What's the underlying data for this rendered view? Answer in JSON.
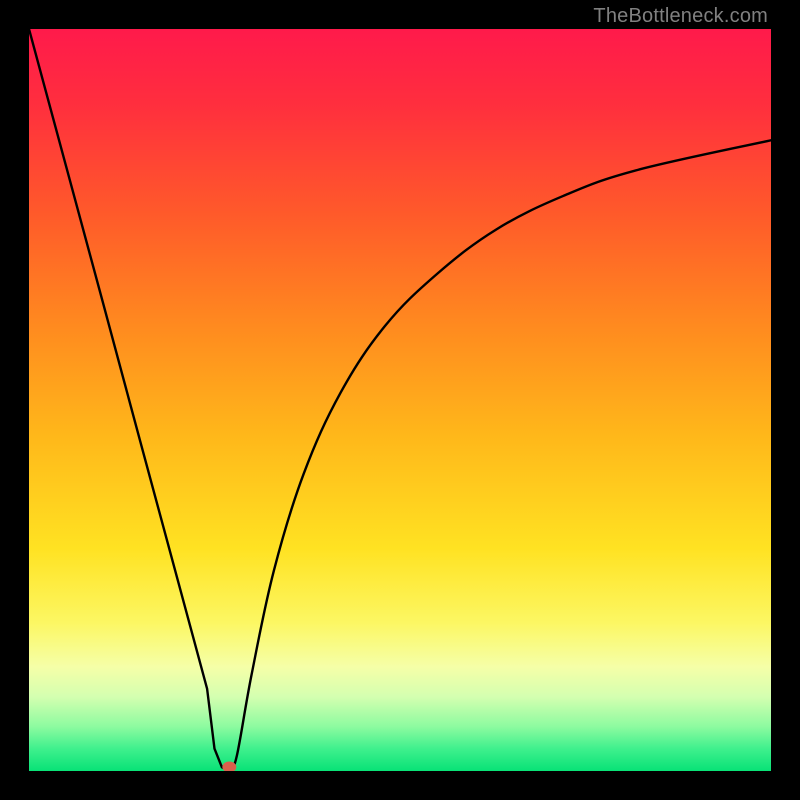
{
  "attribution": "TheBottleneck.com",
  "chart_data": {
    "type": "line",
    "title": "",
    "xlabel": "",
    "ylabel": "",
    "xlim": [
      0,
      100
    ],
    "ylim": [
      0,
      100
    ],
    "annotations": [],
    "marker": {
      "x": 27,
      "y": 0,
      "color": "#d9604c"
    },
    "series": [
      {
        "name": "left-segment",
        "x": [
          0,
          5,
          10,
          15,
          20,
          24,
          25,
          26,
          27
        ],
        "values": [
          100,
          81.5,
          63,
          44.4,
          25.9,
          11.1,
          3,
          0.5,
          0
        ]
      },
      {
        "name": "right-segment",
        "x": [
          27,
          28,
          30,
          33,
          37,
          42,
          48,
          55,
          63,
          72,
          82,
          100
        ],
        "values": [
          0,
          2,
          13,
          27,
          40,
          51,
          60,
          67,
          73,
          77.5,
          81,
          85
        ]
      }
    ],
    "background_gradient": {
      "stops": [
        {
          "offset": 0.0,
          "color": "#ff1a4b"
        },
        {
          "offset": 0.1,
          "color": "#ff2e3e"
        },
        {
          "offset": 0.25,
          "color": "#ff5a2a"
        },
        {
          "offset": 0.4,
          "color": "#ff8a1f"
        },
        {
          "offset": 0.55,
          "color": "#ffb81a"
        },
        {
          "offset": 0.7,
          "color": "#ffe222"
        },
        {
          "offset": 0.8,
          "color": "#fcf763"
        },
        {
          "offset": 0.86,
          "color": "#f5ffa8"
        },
        {
          "offset": 0.9,
          "color": "#d4ffb0"
        },
        {
          "offset": 0.94,
          "color": "#8dfba0"
        },
        {
          "offset": 0.97,
          "color": "#3ff08d"
        },
        {
          "offset": 1.0,
          "color": "#08e277"
        }
      ]
    }
  }
}
